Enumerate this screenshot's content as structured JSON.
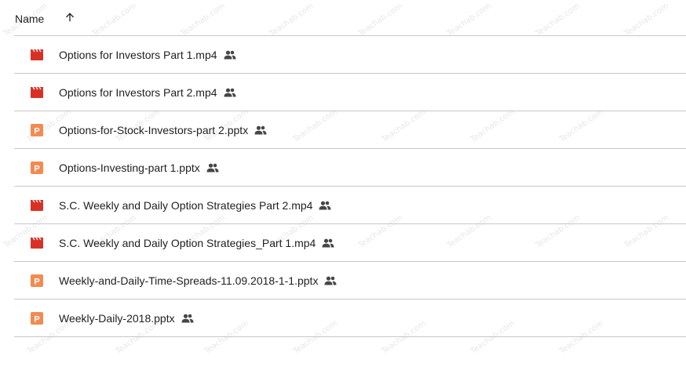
{
  "header": {
    "name_label": "Name",
    "sort_icon": "arrow-up-icon"
  },
  "files": [
    {
      "name": "Options for Investors Part 1.mp4",
      "type": "video",
      "shared": true
    },
    {
      "name": "Options for Investors Part 2.mp4",
      "type": "video",
      "shared": true
    },
    {
      "name": "Options-for-Stock-Investors-part 2.pptx",
      "type": "slides",
      "shared": true
    },
    {
      "name": "Options-Investing-part 1.pptx",
      "type": "slides",
      "shared": true
    },
    {
      "name": "S.C. Weekly and Daily Option Strategies Part 2.mp4",
      "type": "video",
      "shared": true
    },
    {
      "name": "S.C. Weekly and Daily Option Strategies_Part 1.mp4",
      "type": "video",
      "shared": true
    },
    {
      "name": "Weekly-and-Daily-Time-Spreads-11.09.2018-1-1.pptx",
      "type": "slides",
      "shared": true
    },
    {
      "name": "Weekly-Daily-2018.pptx",
      "type": "slides",
      "shared": true
    }
  ],
  "icons": {
    "video": "video-file-icon",
    "slides": "slides-file-icon",
    "shared": "shared-people-icon"
  },
  "colors": {
    "video": "#d93025",
    "slides": "#f28b50",
    "divider": "#c7c7c7",
    "text": "#1f1f1f",
    "shared_icon": "#444746"
  },
  "watermark": {
    "text": "Teachab.com"
  }
}
